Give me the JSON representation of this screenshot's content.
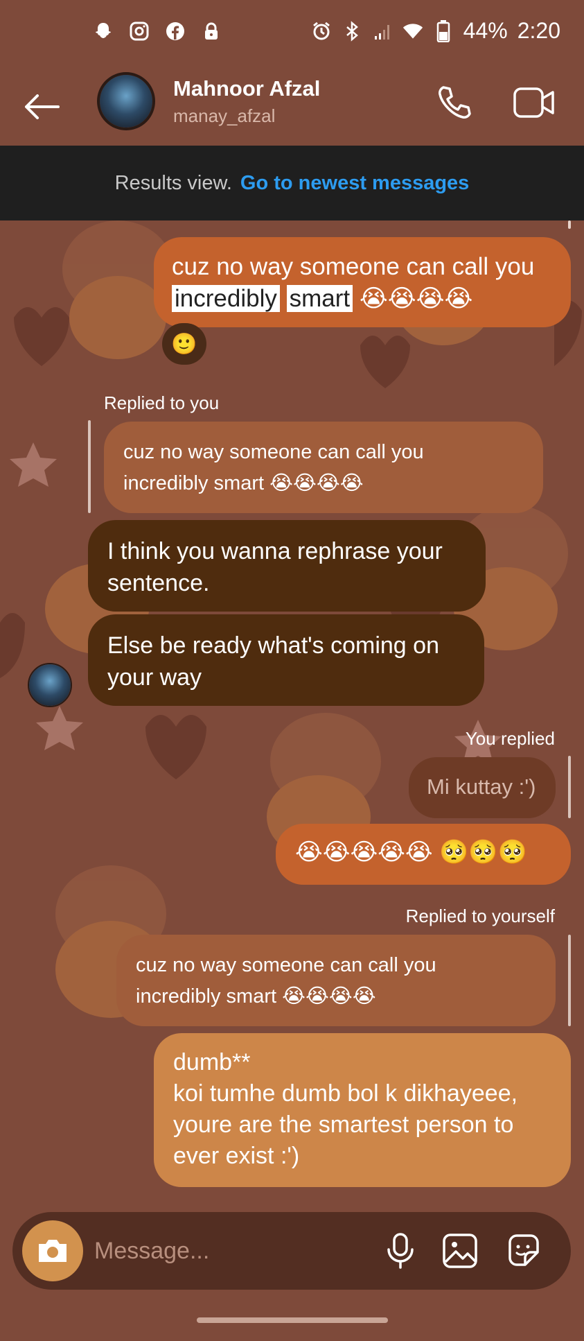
{
  "status_bar": {
    "left_icons": [
      "snapchat-icon",
      "instagram-icon",
      "facebook-icon",
      "lock-icon"
    ],
    "right_icons": [
      "alarm-icon",
      "bluetooth-icon",
      "signal-icon",
      "wifi-icon",
      "battery-icon"
    ],
    "battery": "44%",
    "time": "2:20"
  },
  "header": {
    "name": "Mahnoor Afzal",
    "handle": "manay_afzal"
  },
  "results_banner": {
    "label": "Results view.",
    "link": "Go to newest messages"
  },
  "messages": {
    "m1": {
      "line1": "cuz no way someone can call you",
      "hl1": "incredibly",
      "hl2": "smart",
      "emojis": "😭😭😭😭",
      "reaction": "🙂"
    },
    "r1": {
      "label": "Replied to you",
      "quote1": "cuz no way someone can call you",
      "quote2": "incredibly smart 😭😭😭😭"
    },
    "m2": {
      "text": "I think you wanna rephrase your sentence."
    },
    "m3": {
      "text": "Else be ready what's coming on your way"
    },
    "r2": {
      "label": "You replied",
      "quote": "Mi kuttay :')"
    },
    "m4": {
      "text": "😭😭😭😭😭 🥺🥺🥺"
    },
    "r3": {
      "label": "Replied to yourself",
      "quote1": "cuz no way someone can call you",
      "quote2": "incredibly smart 😭😭😭😭"
    },
    "m5": {
      "line1": "dumb**",
      "line2": "koi tumhe dumb bol k dikhayeee,",
      "line3": "youre are the smartest person to",
      "line4": "ever exist :')"
    }
  },
  "composer": {
    "placeholder": "Message..."
  },
  "colors": {
    "background": "#7e4a3a",
    "sent": "#c4622d",
    "received": "#4f2c0e",
    "link": "#2d9cf0"
  }
}
